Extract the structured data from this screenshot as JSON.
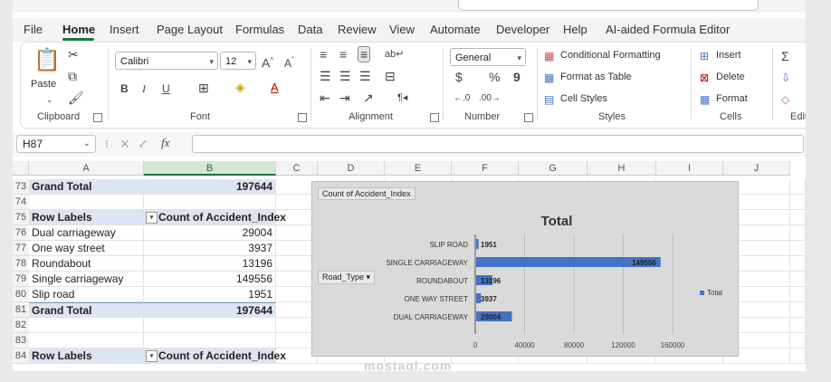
{
  "menu": {
    "items": [
      "File",
      "Home",
      "Insert",
      "Page Layout",
      "Formulas",
      "Data",
      "Review",
      "View",
      "Automate",
      "Developer",
      "Help",
      "AI-aided Formula Editor"
    ],
    "active": "Home"
  },
  "ribbon": {
    "clipboard": {
      "paste_label": "Paste",
      "group_label": "Clipboard"
    },
    "font": {
      "font_name": "Calibri",
      "font_size": "12",
      "group_label": "Font"
    },
    "alignment": {
      "group_label": "Alignment"
    },
    "number": {
      "format": "General",
      "currency": "$",
      "percent": "%",
      "comma": "9",
      "group_label": "Number"
    },
    "styles": {
      "conditional": "Conditional Formatting",
      "format_table": "Format as Table",
      "cell_styles": "Cell Styles",
      "group_label": "Styles"
    },
    "cells": {
      "insert": "Insert",
      "delete": "Delete",
      "format": "Format",
      "group_label": "Cells"
    },
    "editing": {
      "sum": "Σ",
      "group_label": "Editin"
    }
  },
  "formula_bar": {
    "name_box": "H87",
    "fx": "fx",
    "value": ""
  },
  "columns": [
    "A",
    "B",
    "C",
    "D",
    "E",
    "F",
    "G",
    "H",
    "I",
    "J"
  ],
  "selected_column": "B",
  "rows": [
    {
      "num": "73",
      "a": "Grand Total",
      "b": "197644",
      "style": "grand-top"
    },
    {
      "num": "74",
      "a": "",
      "b": "",
      "style": ""
    },
    {
      "num": "75",
      "a": "Row Labels",
      "b": "Count of Accident_Index",
      "style": "header"
    },
    {
      "num": "76",
      "a": "Dual carriageway",
      "b": "29004",
      "style": ""
    },
    {
      "num": "77",
      "a": "One way street",
      "b": "3937",
      "style": ""
    },
    {
      "num": "78",
      "a": "Roundabout",
      "b": "13196",
      "style": ""
    },
    {
      "num": "79",
      "a": "Single carriageway",
      "b": "149556",
      "style": ""
    },
    {
      "num": "80",
      "a": "Slip road",
      "b": "1951",
      "style": ""
    },
    {
      "num": "81",
      "a": "Grand Total",
      "b": "197644",
      "style": "grand"
    },
    {
      "num": "82",
      "a": "",
      "b": "",
      "style": ""
    },
    {
      "num": "83",
      "a": "",
      "b": "",
      "style": ""
    },
    {
      "num": "84",
      "a": "Row Labels",
      "b": "Count of Accident_Index",
      "style": "header"
    }
  ],
  "chart_data": {
    "type": "bar",
    "orientation": "horizontal",
    "title": "Total",
    "field_button": "Count of Accident_Index",
    "axis_field_button": "Road_Type",
    "categories": [
      "SLIP ROAD",
      "SINGLE CARRIAGEWAY",
      "ROUNDABOUT",
      "ONE WAY STREET",
      "DUAL CARRIAGEWAY"
    ],
    "series": [
      {
        "name": "Total",
        "values": [
          1951,
          149556,
          13196,
          3937,
          29004
        ],
        "color": "#4472c4"
      }
    ],
    "xticks": [
      "0",
      "40000",
      "80000",
      "120000",
      "160000"
    ],
    "xlim": [
      0,
      160000
    ],
    "grid": true,
    "legend": "right"
  },
  "watermark": "mostaql.com"
}
